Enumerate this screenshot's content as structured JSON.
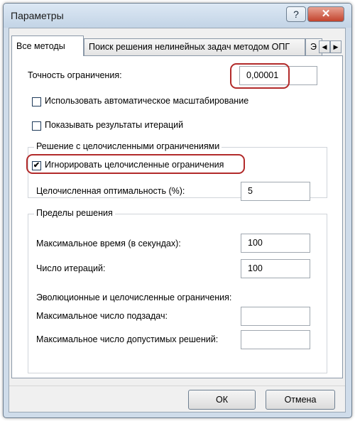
{
  "window": {
    "title": "Параметры",
    "help_glyph": "?",
    "close_glyph": "✕"
  },
  "tabs": [
    {
      "label": "Все методы"
    },
    {
      "label": "Поиск решения нелинейных задач методом ОПГ"
    },
    {
      "label": "Э"
    }
  ],
  "tab_scroll": {
    "left": "◀",
    "right": "▶"
  },
  "precision": {
    "label": "Точность ограничения:",
    "value": "0,00001"
  },
  "options": {
    "auto_scaling": {
      "label": "Использовать автоматическое масштабирование",
      "checked": false
    },
    "show_iterations": {
      "label": "Показывать результаты итераций",
      "checked": false
    }
  },
  "integer_group": {
    "title": "Решение с целочисленными ограничениями",
    "ignore_integer": {
      "label": "Игнорировать целочисленные ограничения",
      "checked": true,
      "mark": "✔"
    },
    "optimality_label": "Целочисленная оптимальность (%):",
    "optimality_value": "5"
  },
  "limits_group": {
    "title": "Пределы решения",
    "max_time_label": "Максимальное время (в секундах):",
    "max_time_value": "100",
    "iterations_label": "Число итераций:",
    "iterations_value": "100",
    "evolutionary_title": "Эволюционные и целочисленные ограничения:",
    "max_subproblems_label": "Максимальное число подзадач:",
    "max_subproblems_value": "",
    "max_solutions_label": "Максимальное число допустимых решений:",
    "max_solutions_value": ""
  },
  "buttons": {
    "ok": "ОК",
    "cancel": "Отмена"
  }
}
